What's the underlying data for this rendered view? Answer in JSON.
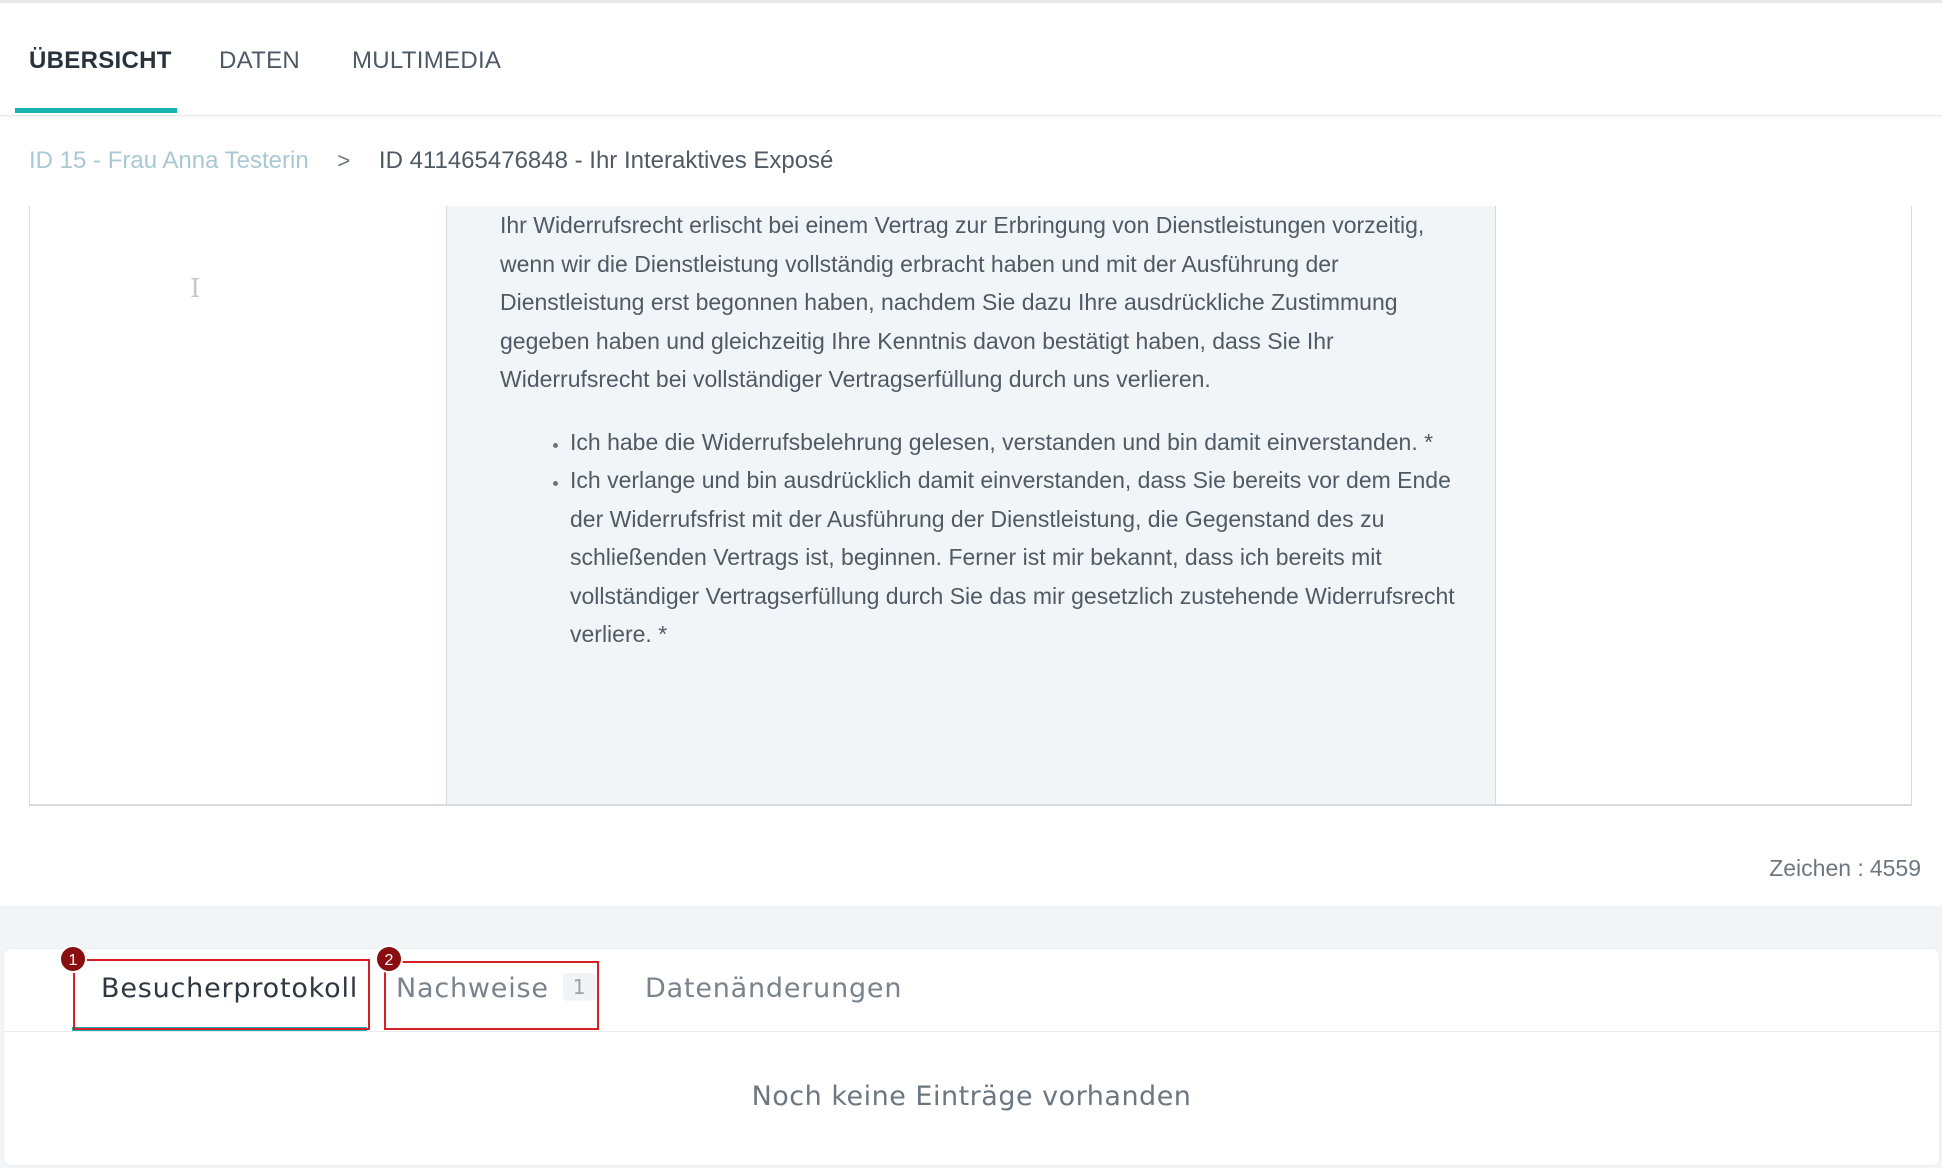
{
  "top_nav": {
    "tabs": [
      {
        "label": "ÜBERSICHT",
        "active": true
      },
      {
        "label": "DATEN",
        "active": false
      },
      {
        "label": "MULTIMEDIA",
        "active": false
      }
    ]
  },
  "breadcrumb": {
    "parent": "ID 15 - Frau Anna Testerin",
    "separator": ">",
    "current": "ID 411465476848 - Ihr Interaktives Exposé"
  },
  "document": {
    "paragraph": "Ihr Widerrufsrecht erlischt bei einem Vertrag zur Erbringung von Dienstleistungen vorzeitig, wenn wir die Dienstleistung vollständig erbracht haben und mit der Ausführung der Dienstleistung erst begonnen haben, nachdem Sie dazu Ihre ausdrückliche Zustimmung gegeben haben und gleichzeitig Ihre Kenntnis davon bestätigt haben, dass Sie Ihr Widerrufsrecht bei vollständiger Vertragserfüllung durch uns verlieren.",
    "bullets": [
      "Ich habe die Widerrufsbelehrung gelesen, verstanden und bin damit einverstanden. *",
      "Ich verlange und bin ausdrücklich damit einverstanden, dass Sie bereits vor dem Ende der Widerrufsfrist mit der Ausführung der Dienstleistung, die Gegenstand des zu schließenden Vertrags ist, beginnen. Ferner ist mir bekannt, dass ich bereits mit vollständiger Vertragserfüllung durch Sie das mir gesetzlich zustehende Widerrufsrecht verliere. *"
    ]
  },
  "char_count": {
    "label": "Zeichen :",
    "value": "4559"
  },
  "bottom_tabs": {
    "tabs": [
      {
        "label": "Besucherprotokoll",
        "active": true
      },
      {
        "label": "Nachweise",
        "badge": "1",
        "active": false
      },
      {
        "label": "Datenänderungen",
        "active": false
      }
    ],
    "markers": [
      "1",
      "2"
    ],
    "empty_message": "Noch keine Einträge vorhanden"
  },
  "colors": {
    "accent": "#17b3b0",
    "highlight": "#d81f26",
    "marker": "#8a0d10"
  }
}
